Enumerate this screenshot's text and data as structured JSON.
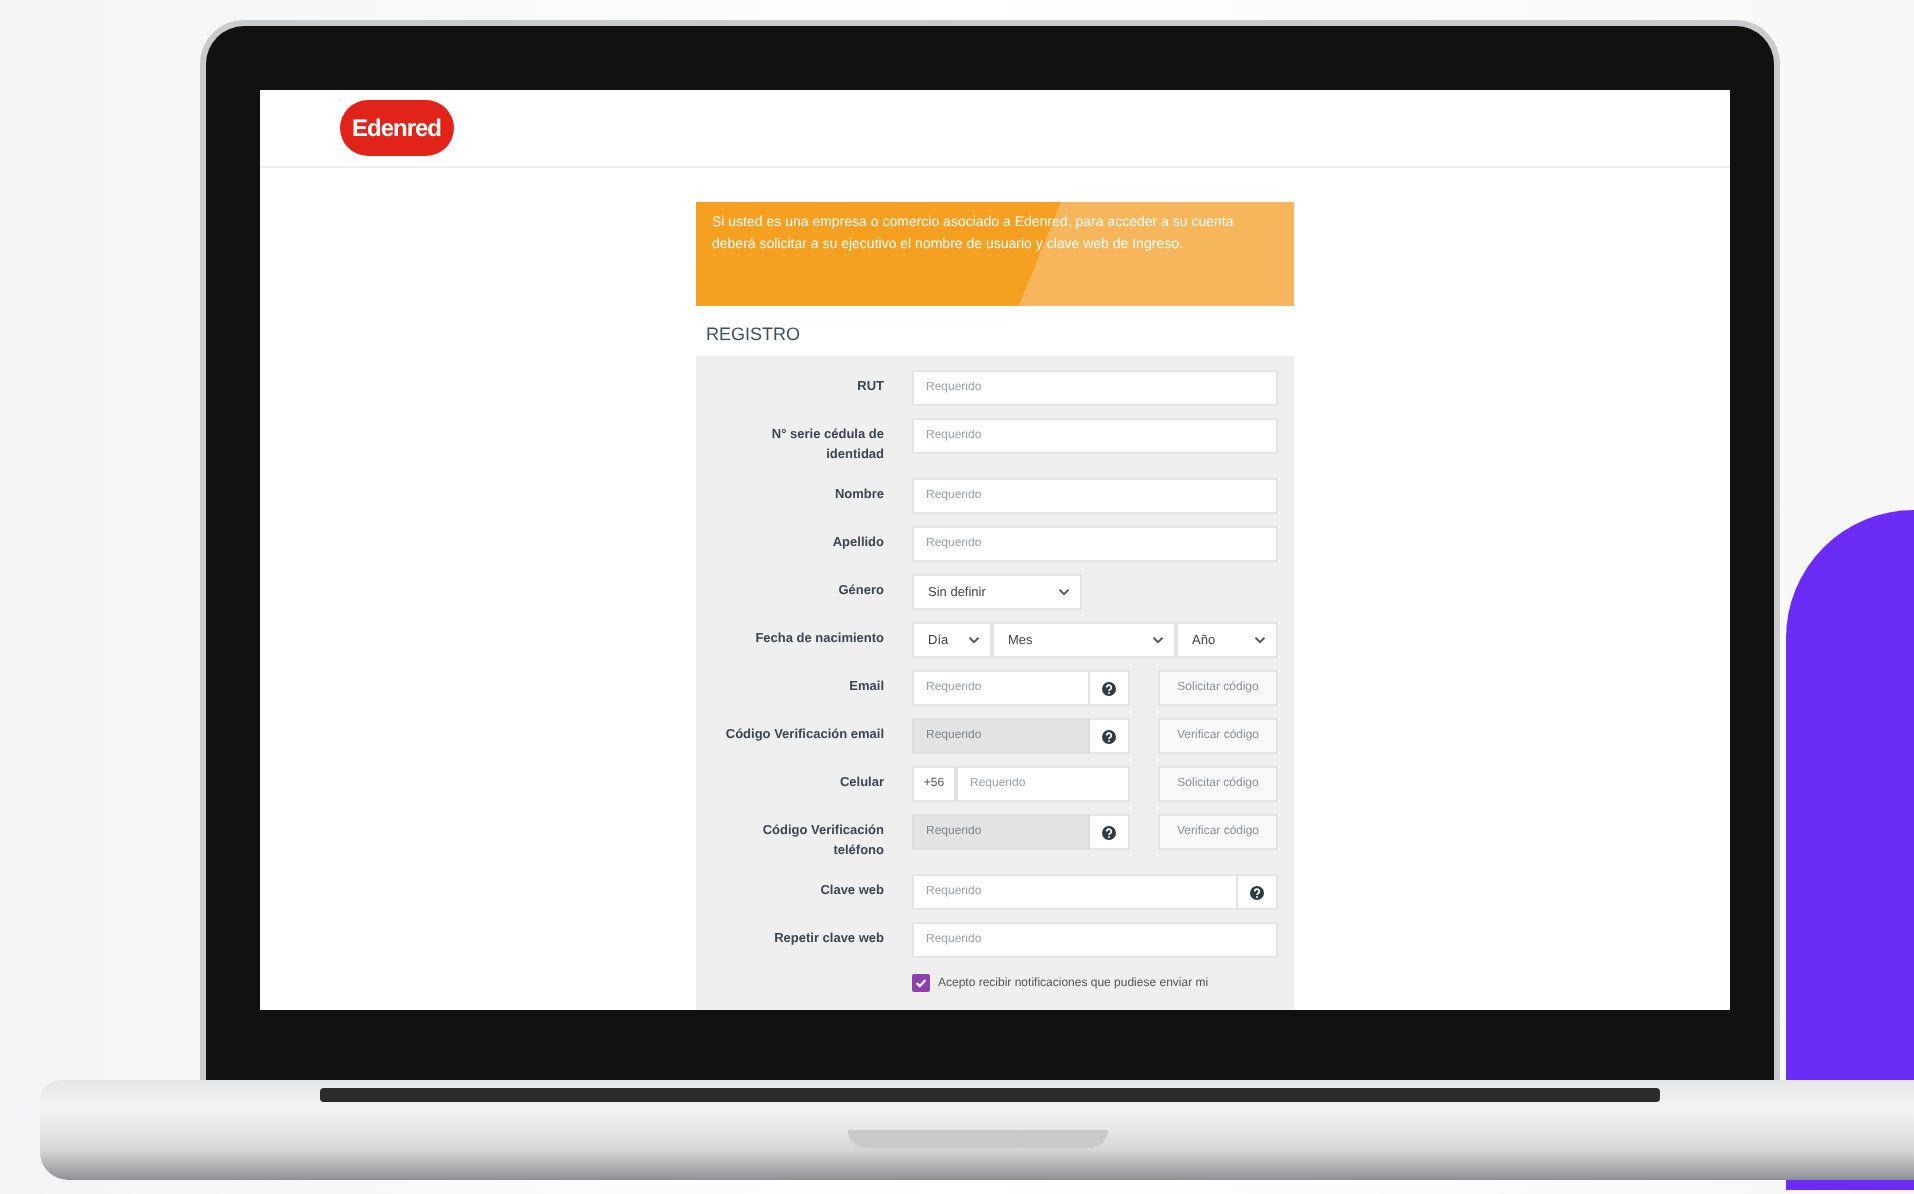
{
  "logo": {
    "text": "Edenred"
  },
  "notice": {
    "text": "Si usted es una empresa o comercio asociado a Edenred, para acceder a su cuenta deberá solicitar a su ejecutivo el nombre de usuario y clave web de Ingreso."
  },
  "section_title": "REGISTRO",
  "fields": [
    {
      "kind": "text",
      "label": "RUT",
      "placeholder": "Requerido"
    },
    {
      "kind": "text",
      "label": "N° serie cédula de identidad",
      "placeholder": "Requerido"
    },
    {
      "kind": "text",
      "label": "Nombre",
      "placeholder": "Requerido"
    },
    {
      "kind": "text",
      "label": "Apellido",
      "placeholder": "Requerido"
    },
    {
      "kind": "select",
      "label": "Género",
      "value": "Sin definir"
    },
    {
      "kind": "date",
      "label": "Fecha de nacimiento",
      "selects": [
        "Día",
        "Mes",
        "Año"
      ]
    },
    {
      "kind": "verify",
      "label": "Email",
      "placeholder": "Requerido",
      "disabled": false,
      "button": "Solicitar código"
    },
    {
      "kind": "verify",
      "label": "Código Verificación email",
      "placeholder": "Requerido",
      "disabled": true,
      "button": "Verificar código"
    },
    {
      "kind": "phone",
      "label": "Celular",
      "prefix": "+56",
      "placeholder": "Requerido",
      "button": "Solicitar código"
    },
    {
      "kind": "verify",
      "label": "Código Verificación teléfono",
      "placeholder": "Requerido",
      "disabled": true,
      "button": "Verificar código"
    },
    {
      "kind": "password",
      "label": "Clave web",
      "placeholder": "Requerido"
    },
    {
      "kind": "text",
      "label": "Repetir clave web",
      "placeholder": "Requerido"
    }
  ],
  "consent": {
    "label": "Acepto recibir notificaciones que pudiese enviar mi",
    "checked": true
  }
}
